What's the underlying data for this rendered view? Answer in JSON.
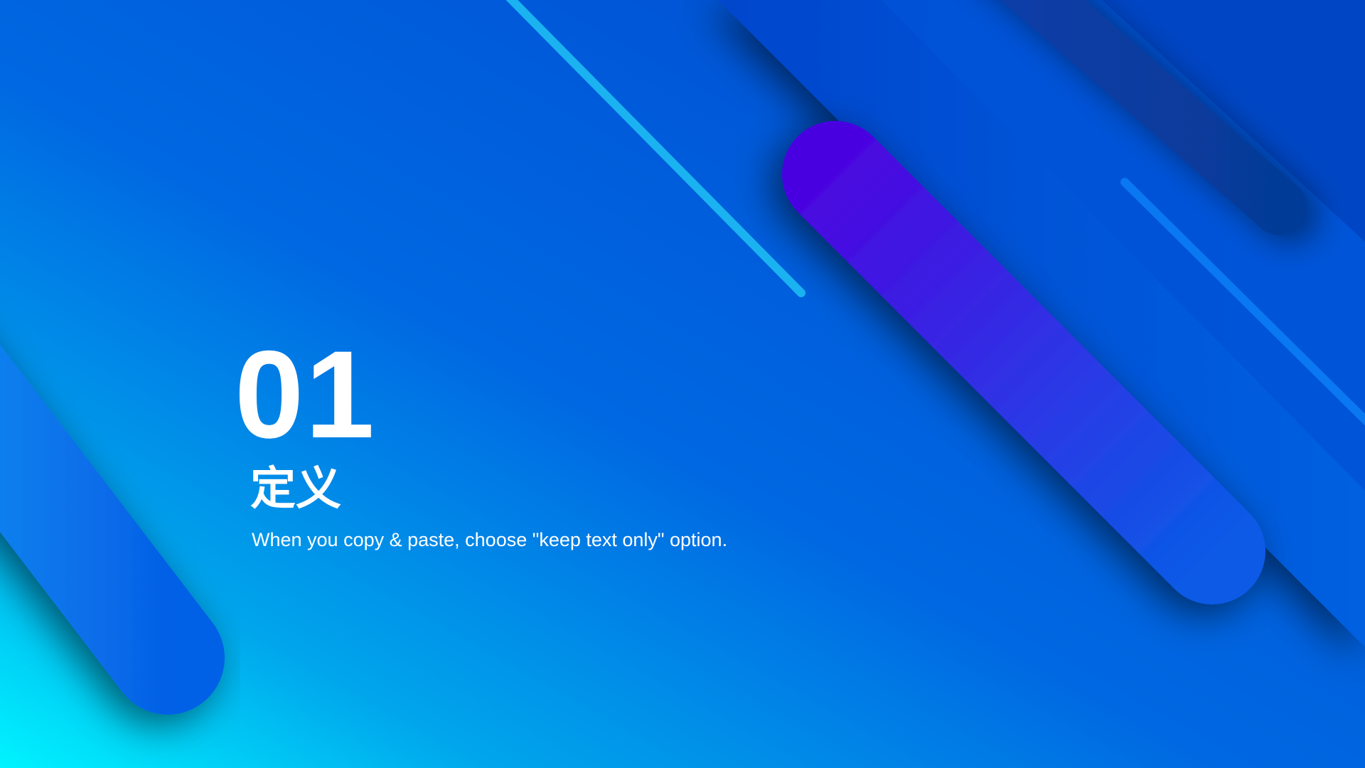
{
  "slide": {
    "number": "01",
    "title": "定义",
    "subtitle": "When you copy & paste, choose \"keep text only\" option."
  },
  "colors": {
    "background_top_left": "#0a86e8",
    "background_bottom_left": "#00f0ff",
    "background_right": "#0044cc",
    "accent_stripe_light": "#1ab2f0",
    "accent_bar_purple": "#4a10e8",
    "text": "#ffffff"
  }
}
